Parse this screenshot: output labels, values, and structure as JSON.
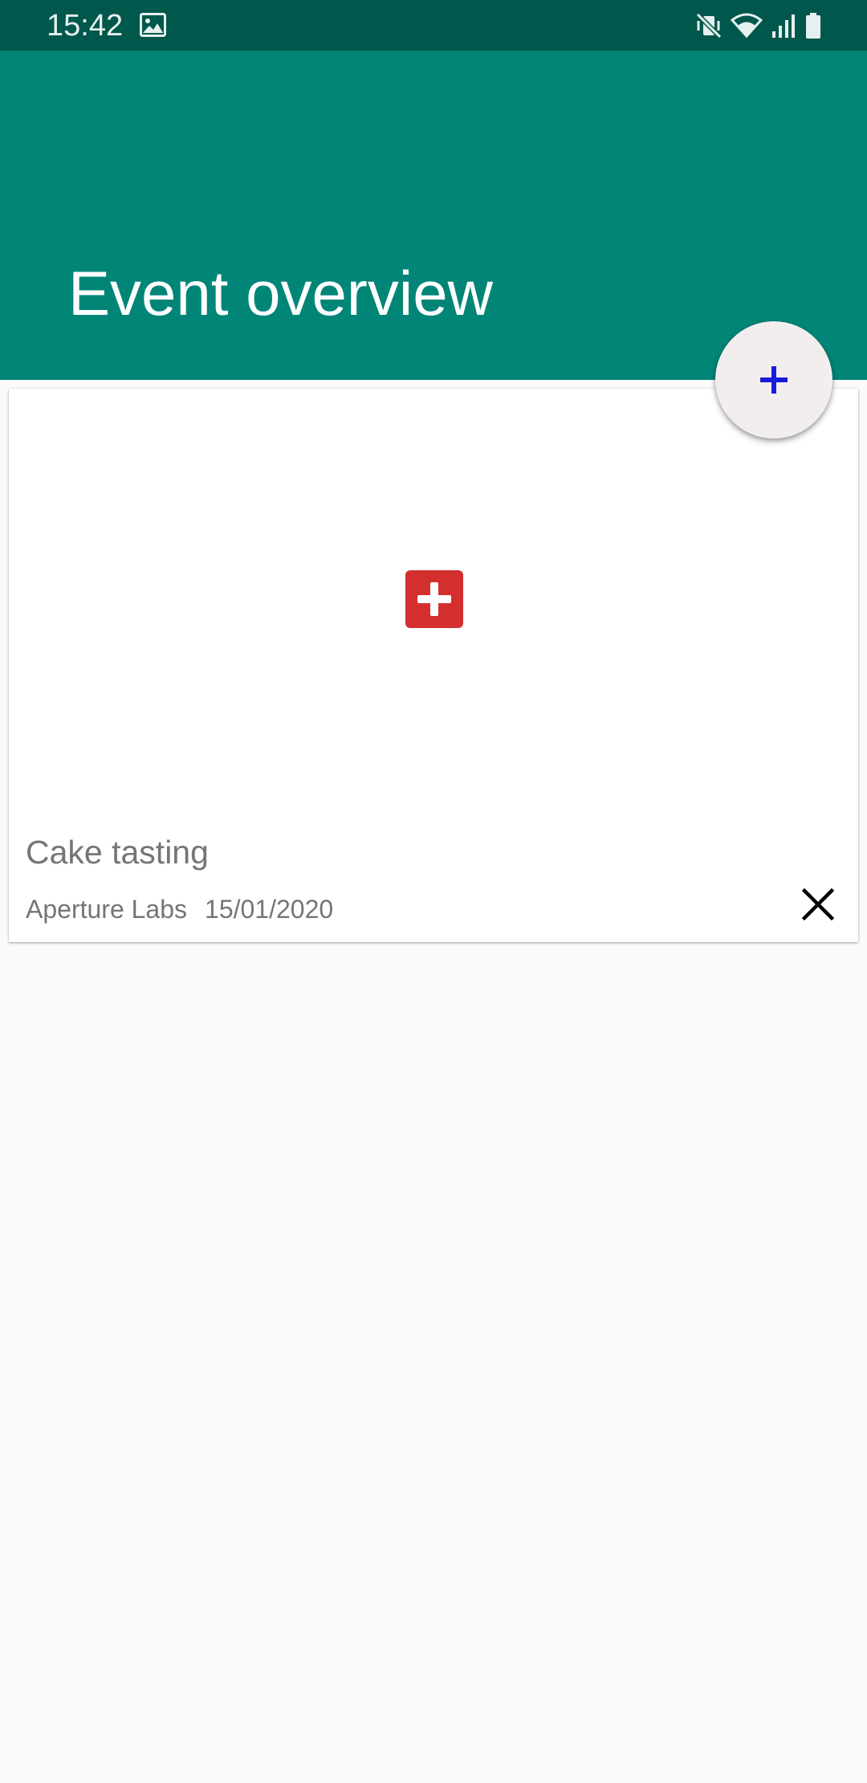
{
  "status_bar": {
    "time": "15:42",
    "left_icons": [
      "gallery-icon"
    ],
    "right_icons": [
      "vibrate-mute-icon",
      "wifi-icon",
      "signal-icon",
      "battery-icon"
    ]
  },
  "app_bar": {
    "title": "Event overview",
    "color": "#008577",
    "status_color": "#00574b"
  },
  "events": [
    {
      "title": "Cake tasting",
      "organizer": "Aperture Labs",
      "date": "15/01/2020",
      "image_icon": "red-cross-icon",
      "image_color": "#d32f2f",
      "delete_icon": "close-icon"
    }
  ],
  "fab": {
    "icon": "plus-icon",
    "icon_color": "#1a1adb"
  }
}
